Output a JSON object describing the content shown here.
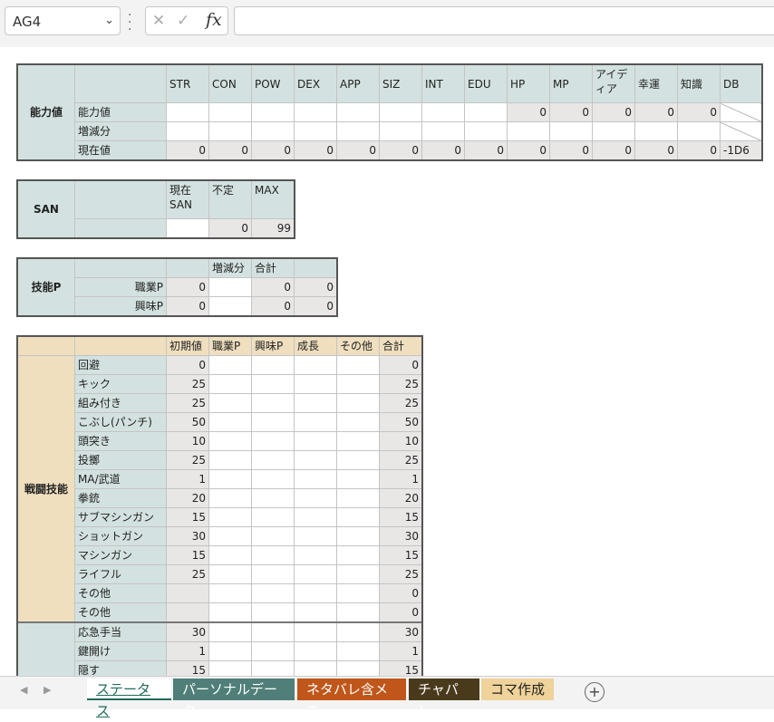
{
  "formula_bar": {
    "name_box": "AG4",
    "formula": ""
  },
  "ability": {
    "section_label": "能力値",
    "headers": [
      "STR",
      "CON",
      "POW",
      "DEX",
      "APP",
      "SIZ",
      "INT",
      "EDU",
      "HP",
      "MP",
      "アイディア",
      "幸運",
      "知識",
      "DB"
    ],
    "row_labels": [
      "能力値",
      "増減分",
      "現在値"
    ],
    "row1_values": [
      "",
      "",
      "",
      "",
      "",
      "",
      "",
      "",
      "0",
      "0",
      "0",
      "0",
      "0",
      ""
    ],
    "row3_values": [
      "0",
      "0",
      "0",
      "0",
      "0",
      "0",
      "0",
      "0",
      "0",
      "0",
      "0",
      "0",
      "0",
      "-1D6"
    ]
  },
  "san": {
    "section_label": "SAN",
    "headers": [
      "現在SAN",
      "不定",
      "MAX"
    ],
    "values": [
      "",
      "0",
      "99"
    ]
  },
  "skill_points": {
    "section_label": "技能P",
    "headers": [
      "",
      "増減分",
      "合計",
      ""
    ],
    "rows": [
      {
        "label": "職業P",
        "base": "0",
        "mod": "",
        "total": "0",
        "extra": "0"
      },
      {
        "label": "興味P",
        "base": "0",
        "mod": "",
        "total": "0",
        "extra": "0"
      }
    ]
  },
  "skills": {
    "headers": [
      "初期値",
      "職業P",
      "興味P",
      "成長",
      "その他",
      "合計"
    ],
    "combat_label": "戦闘技能",
    "combat": [
      {
        "name": "回避",
        "init": "0",
        "total": "0"
      },
      {
        "name": "キック",
        "init": "25",
        "total": "25"
      },
      {
        "name": "組み付き",
        "init": "25",
        "total": "25"
      },
      {
        "name": "こぶし(パンチ)",
        "init": "50",
        "total": "50"
      },
      {
        "name": "頭突き",
        "init": "10",
        "total": "10"
      },
      {
        "name": "投擲",
        "init": "25",
        "total": "25"
      },
      {
        "name": "MA/武道",
        "init": "1",
        "total": "1"
      },
      {
        "name": "拳銃",
        "init": "20",
        "total": "20"
      },
      {
        "name": "サブマシンガン",
        "init": "15",
        "total": "15"
      },
      {
        "name": "ショットガン",
        "init": "30",
        "total": "30"
      },
      {
        "name": "マシンガン",
        "init": "15",
        "total": "15"
      },
      {
        "name": "ライフル",
        "init": "25",
        "total": "25"
      },
      {
        "name": "その他",
        "init": "",
        "total": "0"
      },
      {
        "name": "その他",
        "init": "",
        "total": "0"
      }
    ],
    "other": [
      {
        "name": "応急手当",
        "init": "30",
        "total": "30"
      },
      {
        "name": "鍵開け",
        "init": "1",
        "total": "1"
      },
      {
        "name": "隠す",
        "init": "15",
        "total": "15"
      }
    ]
  },
  "tabs": [
    {
      "label": "ステータス",
      "bg": "#ffffff",
      "fg": "#1f6b5a"
    },
    {
      "label": "パーソナルデータ",
      "bg": "#4f7f78",
      "fg": "#ffffff"
    },
    {
      "label": "ネタバレ含メモ",
      "bg": "#c0561a",
      "fg": "#ffffff"
    },
    {
      "label": "チャパレ",
      "bg": "#4a3a1c",
      "fg": "#ffffff"
    },
    {
      "label": "コマ作成",
      "bg": "#efd39a",
      "fg": "#222222"
    }
  ]
}
